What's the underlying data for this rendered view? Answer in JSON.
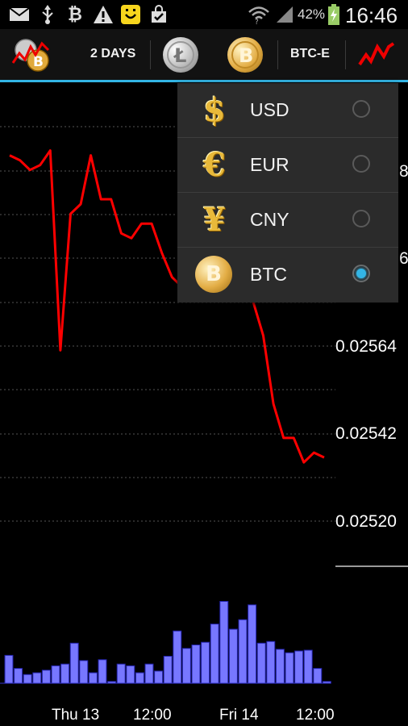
{
  "status_bar": {
    "battery_percent": "42%",
    "time": "16:46",
    "icons": [
      "mail-icon",
      "usb-icon",
      "bitcoin-icon",
      "warning-icon",
      "smiley-app-icon",
      "shopping-bag-icon",
      "wifi-icon",
      "signal-icon",
      "battery-charging-icon"
    ]
  },
  "action_bar": {
    "app_icon": "chart-coin-app-icon",
    "period_label": "2 DAYS",
    "coin_left": "litecoin-icon",
    "coin_right": "bitcoin-icon",
    "exchange_label": "BTC-E",
    "chart_type_icon": "line-chart-icon",
    "accent_color": "#33b5e5"
  },
  "chart_data": {
    "type": "line",
    "series": [
      {
        "values": [
          0.02593,
          0.02592,
          0.0259,
          0.02591,
          0.02594,
          0.02553,
          0.02581,
          0.02583,
          0.02593,
          0.02584,
          0.02584,
          0.02577,
          0.02576,
          0.02579,
          0.02579,
          0.02573,
          0.02568,
          0.02566,
          0.02564,
          0.02574,
          0.02576,
          0.02573,
          0.02575,
          0.02571,
          0.02563,
          0.02556,
          0.02542,
          0.02535,
          0.02535,
          0.0253,
          0.02532,
          0.02531
        ],
        "color": "#ff0000"
      }
    ],
    "y_tick_labels": [
      "0.02564",
      "0.02542",
      "0.02520"
    ],
    "y_tick_labels_partial": [
      "8",
      "6"
    ],
    "ylim": [
      0.02509,
      0.02608
    ],
    "x_tick_labels": [
      "Thu 13",
      "12:00",
      "Fri 14",
      "12:00"
    ],
    "volume_bars": [
      0.32,
      0.17,
      0.1,
      0.12,
      0.15,
      0.2,
      0.22,
      0.46,
      0.26,
      0.12,
      0.27,
      0.02,
      0.22,
      0.2,
      0.12,
      0.22,
      0.14,
      0.31,
      0.6,
      0.4,
      0.44,
      0.47,
      0.68,
      0.94,
      0.62,
      0.73,
      0.9,
      0.46,
      0.48,
      0.39,
      0.35,
      0.37,
      0.38,
      0.17,
      0.02
    ],
    "volume_color": "#7777ff",
    "grid": true
  },
  "currency_menu": {
    "items": [
      {
        "label": "USD",
        "symbol": "$",
        "icon": "dollar-icon",
        "selected": false
      },
      {
        "label": "EUR",
        "symbol": "€",
        "icon": "euro-icon",
        "selected": false
      },
      {
        "label": "CNY",
        "symbol": "¥",
        "icon": "yuan-icon",
        "selected": false
      },
      {
        "label": "BTC",
        "symbol": "B",
        "icon": "bitcoin-coin-icon",
        "selected": true
      }
    ]
  }
}
